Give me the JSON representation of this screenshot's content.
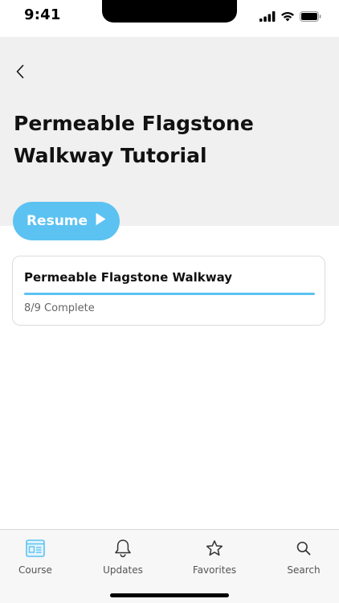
{
  "status_bar": {
    "time": "9:41"
  },
  "header": {
    "back_icon": "chevron-left-icon",
    "title": "Permeable Flagstone Walkway Tutorial"
  },
  "resume": {
    "label": "Resume",
    "icon": "play-icon",
    "color": "#5cc2f2"
  },
  "course_card": {
    "title": "Permeable Flagstone Walkway",
    "completed": 8,
    "total": 9,
    "progress_text": "8/9 Complete",
    "progress_fraction": 1.0
  },
  "tab_bar": {
    "tabs": [
      {
        "label": "Course",
        "icon": "course-icon",
        "active": true
      },
      {
        "label": "Updates",
        "icon": "bell-icon",
        "active": false
      },
      {
        "label": "Favorites",
        "icon": "star-icon",
        "active": false
      },
      {
        "label": "Search",
        "icon": "search-icon",
        "active": false
      }
    ],
    "active_color": "#5cc2f2",
    "inactive_color": "#333333"
  }
}
